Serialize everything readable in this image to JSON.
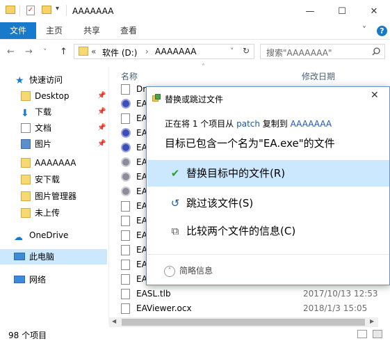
{
  "window": {
    "title": "AAAAAAA",
    "controls": {
      "minimize": "—",
      "maximize": "☐",
      "close": "✕"
    }
  },
  "ribbon": {
    "tabs": [
      "文件",
      "主页",
      "共享",
      "查看"
    ],
    "expand": "˅",
    "help": "?"
  },
  "address": {
    "back": "←",
    "forward": "→",
    "recent": "˅",
    "up": "↑",
    "chevron": "«",
    "crumbs": [
      "软件 (D:)",
      "›",
      "AAAAAAA"
    ],
    "dropdown": "˅",
    "refresh": "↻",
    "search_placeholder": "搜索\"AAAAAAA\""
  },
  "sidebar": {
    "quick_access": "快速访问",
    "items": [
      {
        "label": "Desktop",
        "pinned": true
      },
      {
        "label": "下载",
        "pinned": true
      },
      {
        "label": "文档",
        "pinned": true
      },
      {
        "label": "图片",
        "pinned": true
      },
      {
        "label": "AAAAAAA",
        "pinned": false
      },
      {
        "label": "安下载",
        "pinned": false
      },
      {
        "label": "图片管理器",
        "pinned": false
      },
      {
        "label": "未上传",
        "pinned": false
      }
    ],
    "onedrive": "OneDrive",
    "this_pc": "此电脑",
    "network": "网络"
  },
  "filelist": {
    "col_name": "名称",
    "col_date": "修改日期",
    "rows": [
      {
        "name": "Dr",
        "date": "",
        "icon": "doc"
      },
      {
        "name": "EA",
        "date": "",
        "icon": "round"
      },
      {
        "name": "EA",
        "date": "",
        "icon": "doc"
      },
      {
        "name": "EA",
        "date": "",
        "icon": "round"
      },
      {
        "name": "EA",
        "date": "",
        "icon": "round"
      },
      {
        "name": "EA",
        "date": "",
        "icon": "gray"
      },
      {
        "name": "EA",
        "date": "",
        "icon": "gray"
      },
      {
        "name": "EA",
        "date": "",
        "icon": "gray"
      },
      {
        "name": "EA",
        "date": "",
        "icon": "doc"
      },
      {
        "name": "EA",
        "date": "",
        "icon": "doc"
      },
      {
        "name": "EA",
        "date": "",
        "icon": "doc"
      },
      {
        "name": "EA",
        "date": "",
        "icon": "doc"
      },
      {
        "name": "EA",
        "date": "",
        "icon": "doc"
      },
      {
        "name": "EA",
        "date": "",
        "icon": "doc"
      },
      {
        "name": "EASL.tlb",
        "date": "2017/10/13 12:53",
        "icon": "doc"
      },
      {
        "name": "EAViewer.ocx",
        "date": "2018/1/3 15:05",
        "icon": "doc"
      }
    ]
  },
  "status": {
    "count": "98 个项目"
  },
  "dialog": {
    "title": "替换或跳过文件",
    "close": "✕",
    "line1_prefix": "正在将 1 个项目从 ",
    "line1_src": "patch",
    "line1_mid": " 复制到 ",
    "line1_dst": "AAAAAAA",
    "line2": "目标已包含一个名为\"EA.exe\"的文件",
    "options": [
      {
        "icon": "✔",
        "label": "替换目标中的文件(R)",
        "highlighted": true
      },
      {
        "icon": "↺",
        "label": "跳过该文件(S)",
        "highlighted": false
      },
      {
        "icon": "⧉",
        "label": "比较两个文件的信息(C)",
        "highlighted": false
      }
    ],
    "more_icon": "˄",
    "more": "简略信息"
  },
  "colors": {
    "accent": "#1979ca",
    "selection": "#cce8ff",
    "link": "#1a57b5"
  }
}
